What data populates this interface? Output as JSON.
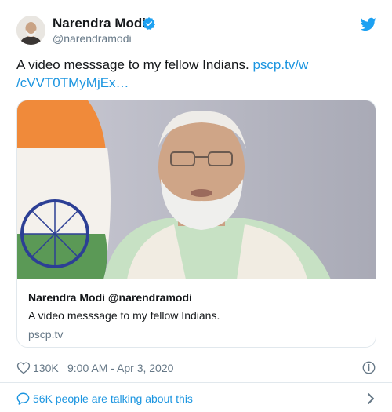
{
  "author": {
    "name": "Narendra Modi",
    "handle": "@narendramodi",
    "verified_icon": "verified-badge-icon",
    "avatar": "profile-photo"
  },
  "brand_icon": "twitter-bird-icon",
  "tweet": {
    "text": "A video messsage to my fellow Indians.",
    "link_line1": "pscp.tv/w",
    "link_line2": "/cVVT0TMyMjEx…"
  },
  "card": {
    "media": "video-still",
    "title": "Narendra Modi @narendramodi",
    "description": "A video messsage to my fellow Indians.",
    "domain": "pscp.tv"
  },
  "meta": {
    "like_icon": "heart-icon",
    "likes": "130K",
    "timestamp": "9:00 AM - Apr 3, 2020",
    "info_icon": "info-icon"
  },
  "footer": {
    "bubble_icon": "speech-bubble-icon",
    "talking": "56K people are talking about this",
    "chevron_icon": "chevron-right-icon"
  },
  "colors": {
    "text": "#14171a",
    "secondary": "#657786",
    "link": "#1b95e0",
    "border": "#e1e8ed"
  }
}
